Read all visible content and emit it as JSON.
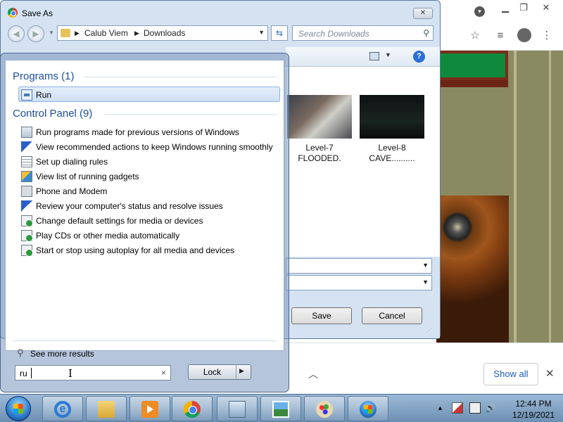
{
  "save_as": {
    "title": "Save As",
    "close_label": "✕",
    "breadcrumb": [
      "Calub Viem",
      "Downloads"
    ],
    "search_placeholder": "Search Downloads",
    "files": [
      {
        "label_line1": "Level-7",
        "label_line2": "FLOODED."
      },
      {
        "label_line1": "Level-8",
        "label_line2": "CAVE.........."
      }
    ],
    "save_label": "Save",
    "cancel_label": "Cancel"
  },
  "start_menu": {
    "programs_header": "Programs (1)",
    "programs": [
      {
        "label": "Run",
        "icon": "run-icon"
      }
    ],
    "control_panel_header": "Control Panel (9)",
    "control_panel": [
      {
        "label": "Run programs made for previous versions of Windows",
        "icon": "compatibility-icon"
      },
      {
        "label": "View recommended actions to keep Windows running smoothly",
        "icon": "action-center-flag-icon"
      },
      {
        "label": "Set up dialing rules",
        "icon": "dialing-rules-icon"
      },
      {
        "label": "View list of running gadgets",
        "icon": "gadgets-icon"
      },
      {
        "label": "Phone and Modem",
        "icon": "phone-modem-icon"
      },
      {
        "label": "Review your computer's status and resolve issues",
        "icon": "action-center-flag-icon"
      },
      {
        "label": "Change default settings for media or devices",
        "icon": "autoplay-icon"
      },
      {
        "label": "Play CDs or other media automatically",
        "icon": "autoplay-icon"
      },
      {
        "label": "Start or stop using autoplay for all media and devices",
        "icon": "autoplay-icon"
      }
    ],
    "see_more": "See more results",
    "search_value": "ru",
    "clear_label": "×",
    "lock_label": "Lock"
  },
  "chrome": {
    "downloads_bar": {
      "show_all": "Show all",
      "close_label": "✕"
    }
  },
  "taskbar": {
    "apps": [
      "internet-explorer-icon",
      "windows-explorer-icon",
      "media-player-icon",
      "chrome-icon",
      "control-panel-icon",
      "photo-viewer-icon",
      "paint-icon",
      "windows-icon"
    ],
    "time": "12:44 PM",
    "date": "12/19/2021"
  }
}
